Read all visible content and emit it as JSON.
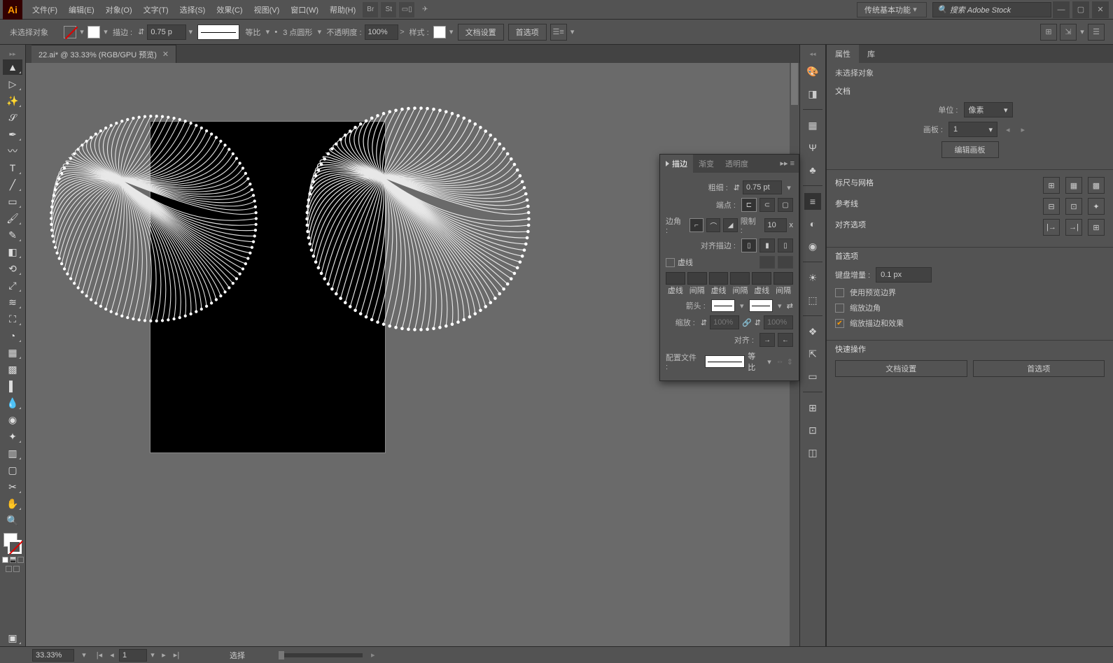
{
  "menu": {
    "items": [
      "文件(F)",
      "编辑(E)",
      "对象(O)",
      "文字(T)",
      "选择(S)",
      "效果(C)",
      "视图(V)",
      "窗口(W)",
      "帮助(H)"
    ],
    "workspace": "传统基本功能",
    "search_ph": "搜索 Adobe Stock"
  },
  "ctrl": {
    "no_sel": "未选择对象",
    "stroke_lbl": "描边 :",
    "stroke_w": "0.75 p",
    "uniform": "等比",
    "pt3round": "3 点圆形",
    "opacity_lbl": "不透明度 :",
    "opacity": "100%",
    "style_lbl": "样式 :",
    "doc_setup": "文档设置",
    "prefs": "首选项",
    "dot": "•"
  },
  "tab": {
    "title": "22.ai* @ 33.33% (RGB/GPU 预览)"
  },
  "strokep": {
    "tabs": [
      "描边",
      "渐变",
      "透明度"
    ],
    "weight_lbl": "粗细 :",
    "weight": "0.75 pt",
    "cap_lbl": "端点 :",
    "corner_lbl": "边角 :",
    "limit_lbl": "限制 :",
    "limit": "10",
    "limit_x": "x",
    "align_lbl": "对齐描边 :",
    "dashed": "虚线",
    "dheads": [
      "虚线",
      "间隔",
      "虚线",
      "间隔",
      "虚线",
      "间隔"
    ],
    "arrow_lbl": "箭头 :",
    "scale_lbl": "缩放 :",
    "scale": "100%",
    "align2": "对齐 :",
    "profile_lbl": "配置文件 :",
    "profile": "等比"
  },
  "prop": {
    "tabs": [
      "属性",
      "库"
    ],
    "no_sel": "未选择对象",
    "doc": "文档",
    "unit_lbl": "单位 :",
    "unit": "像素",
    "artboard_lbl": "画板 :",
    "artboard": "1",
    "edit_ab": "编辑画板",
    "rulers": "标尺与网格",
    "guides": "参考线",
    "align_opts": "对齐选项",
    "prefs": "首选项",
    "key_inc": "键盘增量 :",
    "key_val": "0.1 px",
    "cb1": "使用预览边界",
    "cb2": "缩放边角",
    "cb3": "缩放描边和效果",
    "quick": "快速操作",
    "doc_setup": "文档设置",
    "prefs_btn": "首选项"
  },
  "status": {
    "zoom": "33.33%",
    "page": "1",
    "tool": "选择"
  }
}
